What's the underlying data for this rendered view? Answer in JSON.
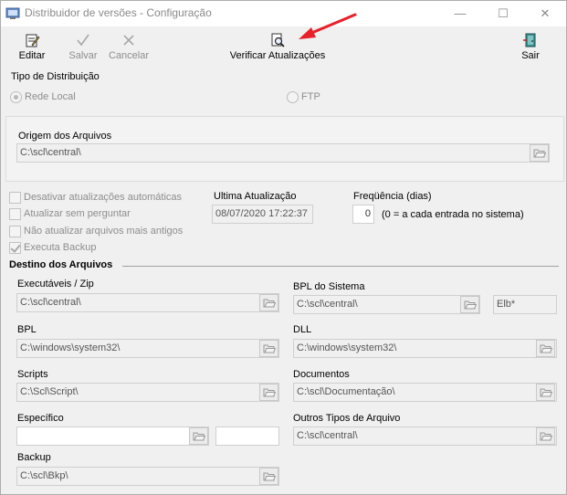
{
  "window": {
    "title": "Distribuidor de versões - Configuração",
    "minimize_glyph": "—",
    "maximize_glyph": "☐",
    "close_glyph": "✕"
  },
  "toolbar": {
    "edit_label": "Editar",
    "save_label": "Salvar",
    "cancel_label": "Cancelar",
    "check_updates_label": "Verificar Atualizações",
    "exit_label": "Sair"
  },
  "distribution": {
    "heading": "Tipo de Distribuição",
    "option_local": "Rede Local",
    "option_ftp": "FTP",
    "selected": "Rede Local"
  },
  "origin": {
    "label": "Origem dos Arquivos",
    "value": "C:\\scl\\central\\"
  },
  "options": {
    "disable_auto_updates": "Desativar atualizações automáticas",
    "update_without_asking": "Atualizar sem perguntar",
    "dont_update_older": "Não atualizar arquivos mais antigos",
    "run_backup": "Executa Backup",
    "run_backup_checked": true
  },
  "last_update": {
    "label": "Ultima Atualização",
    "value": "08/07/2020 17:22:37"
  },
  "frequency": {
    "label": "Freqüência (dias)",
    "value": "0",
    "hint": "(0 = a cada entrada no sistema)"
  },
  "destination": {
    "heading": "Destino dos Arquivos",
    "executables_label": "Executáveis / Zip",
    "executables_value": "C:\\scl\\central\\",
    "bpl_system_label": "BPL do Sistema",
    "bpl_system_value": "C:\\scl\\central\\",
    "bpl_system_mask": "Elb*",
    "bpl_label": "BPL",
    "bpl_value": "C:\\windows\\system32\\",
    "dll_label": "DLL",
    "dll_value": "C:\\windows\\system32\\",
    "scripts_label": "Scripts",
    "scripts_value": "C:\\Scl\\Script\\",
    "documents_label": "Documentos",
    "documents_value": "C:\\scl\\Documentação\\",
    "specific_label": "Específico",
    "specific_value": "",
    "specific_mask": "",
    "other_types_label": "Outros Tipos de Arquivo",
    "other_types_value": "C:\\scl\\central\\",
    "backup_label": "Backup",
    "backup_value": "C:\\scl\\Bkp\\"
  },
  "colors": {
    "annotation_arrow": "#e8202a"
  }
}
